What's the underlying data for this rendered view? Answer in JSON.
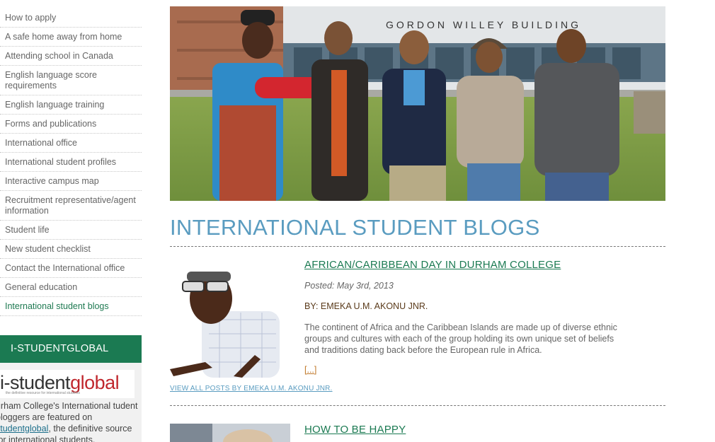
{
  "sidebar": {
    "nav": [
      {
        "label": "How to apply"
      },
      {
        "label": "A safe home away from home"
      },
      {
        "label": "Attending school in Canada"
      },
      {
        "label": "English language score requirements"
      },
      {
        "label": "English language training"
      },
      {
        "label": "Forms and publications"
      },
      {
        "label": "International office"
      },
      {
        "label": "International student profiles"
      },
      {
        "label": "Interactive campus map"
      },
      {
        "label": "Recruitment representative/agent information"
      },
      {
        "label": "Student life"
      },
      {
        "label": "New student checklist"
      },
      {
        "label": "Contact the International office"
      },
      {
        "label": "General education"
      },
      {
        "label": "International student blogs",
        "active": true
      }
    ],
    "promo": {
      "heading": "I-STUDENTGLOBAL",
      "logo_text_a": "i-student",
      "logo_text_b": "global",
      "logo_tagline": "the definitive resource for international students",
      "text_before": "urham College's International tudent bloggers are featured on ",
      "link": "studentglobal",
      "text_after": ", the definitive source for international students."
    }
  },
  "hero": {
    "building_sign": "GORDON WILLEY BUILDING"
  },
  "main": {
    "title": "INTERNATIONAL STUDENT BLOGS",
    "posts": [
      {
        "title": "AFRICAN/CARIBBEAN DAY IN DURHAM COLLEGE",
        "posted": "Posted: May 3rd, 2013",
        "byline": "BY: EMEKA U.M. AKONU JNR.",
        "excerpt": "The continent of Africa and the Caribbean Islands are made up of diverse ethnic groups and cultures with each of the group holding its own unique set of beliefs and traditions dating back before the European rule in Africa.",
        "more": "[...]",
        "view_all": "VIEW ALL POSTS BY EMEKA U.M. AKONU JNR."
      },
      {
        "title": "HOW TO BE HAPPY"
      }
    ]
  },
  "colors": {
    "green": "#1b7a52",
    "blue_title": "#5a9cc0",
    "more_link": "#c0782a"
  }
}
